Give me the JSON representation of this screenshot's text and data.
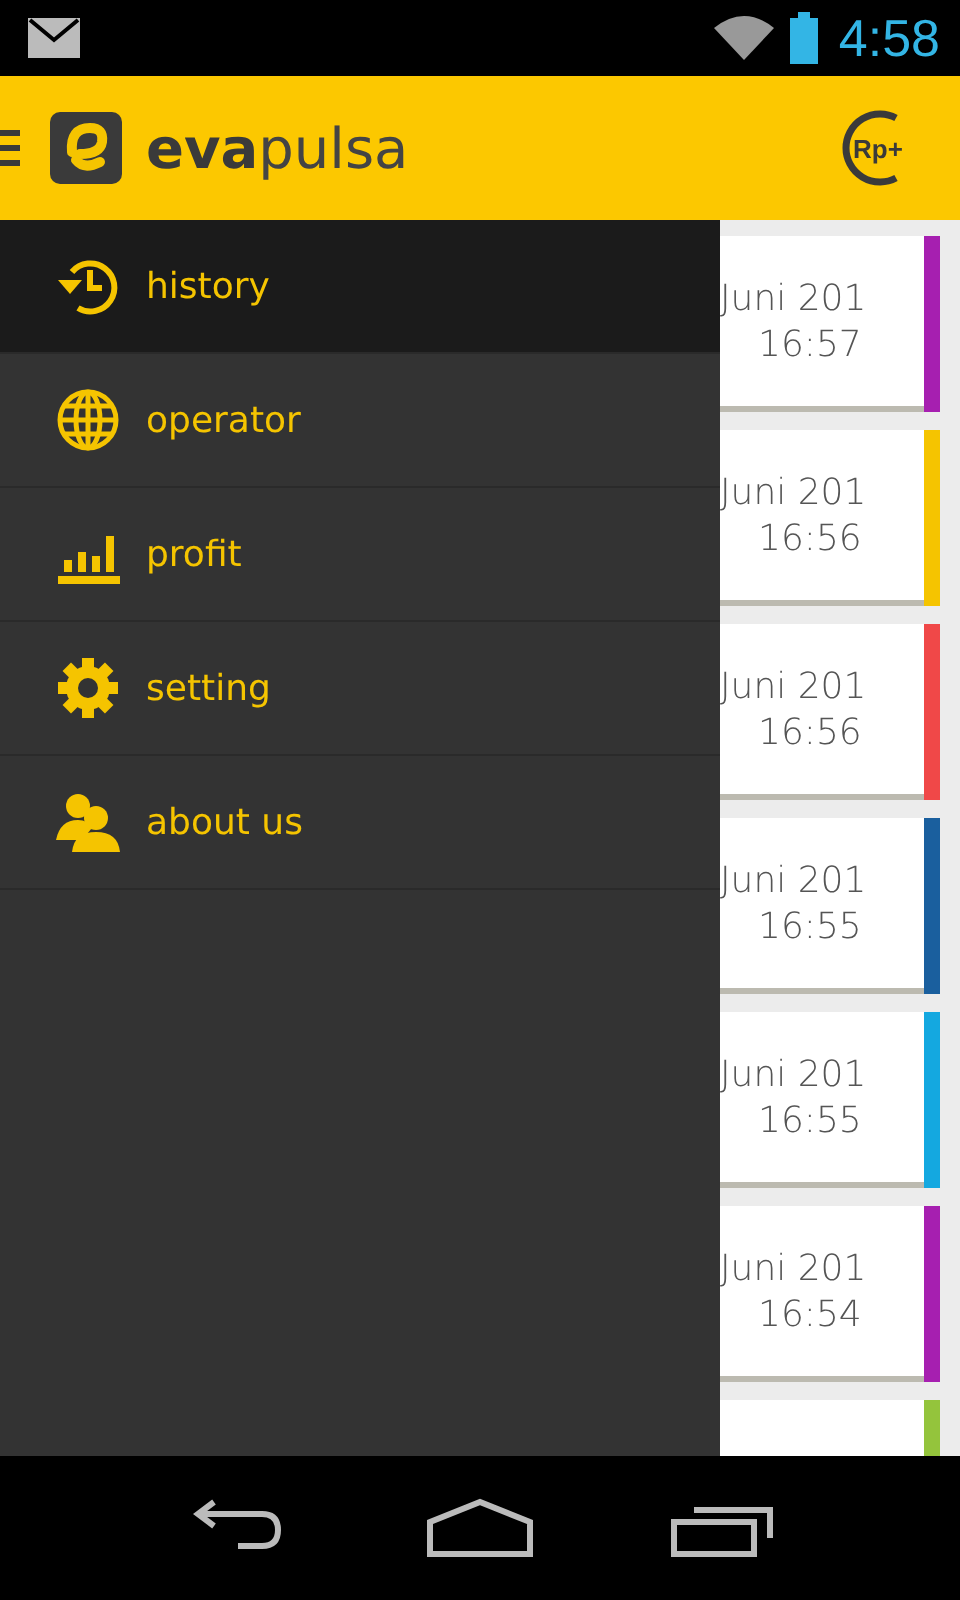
{
  "status_bar": {
    "time": "4:58"
  },
  "app_bar": {
    "title": "**eva**pulsa",
    "topup_label": "Rp+"
  },
  "drawer": {
    "items": [
      {
        "label": "history",
        "kind": "history",
        "selected": true
      },
      {
        "label": "operator",
        "kind": "operator",
        "selected": false
      },
      {
        "label": "profit",
        "kind": "profit",
        "selected": false
      },
      {
        "label": "setting",
        "kind": "setting",
        "selected": false
      },
      {
        "label": "about us",
        "kind": "about",
        "selected": false
      }
    ]
  },
  "transactions": [
    {
      "date": "Juni 201",
      "time": "16:57",
      "color": "#a61fb0"
    },
    {
      "date": "Juni 201",
      "time": "16:56",
      "color": "#f5c400"
    },
    {
      "date": "Juni 201",
      "time": "16:56",
      "color": "#f04848"
    },
    {
      "date": "Juni 201",
      "time": "16:55",
      "color": "#1a5f9e"
    },
    {
      "date": "Juni 201",
      "time": "16:55",
      "color": "#14a8e0"
    },
    {
      "date": "Juni 201",
      "time": "16:54",
      "color": "#a61fb0"
    },
    {
      "color": "#94c43c"
    }
  ]
}
